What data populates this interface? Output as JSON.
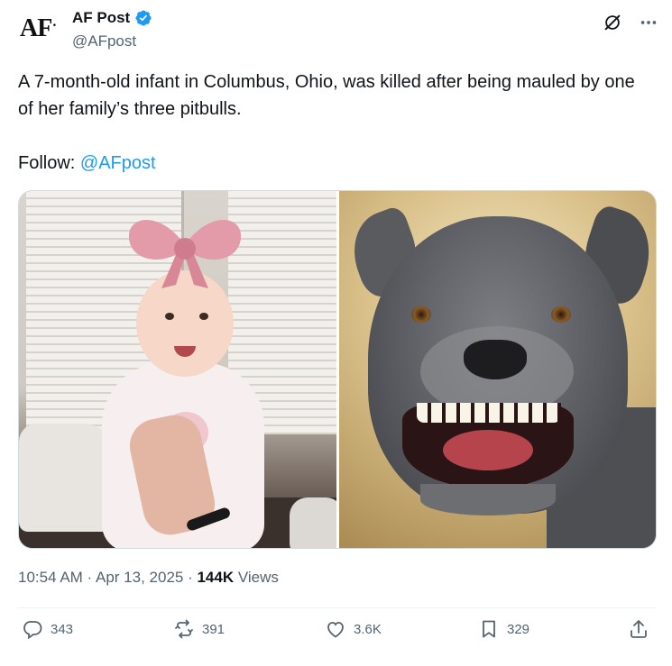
{
  "author": {
    "logo_text": "AF",
    "logo_dot": ".",
    "display_name": "AF Post",
    "handle": "@AFpost"
  },
  "tweet": {
    "text": "A 7-month-old infant in Columbus, Ohio, was killed after being mauled by one of her family’s three pitbulls.",
    "follow_label": "Follow: ",
    "follow_mention": "@AFpost"
  },
  "meta": {
    "time": "10:54 AM",
    "separator": " · ",
    "date": "Apr 13, 2025",
    "views_count": "144K",
    "views_label": " Views"
  },
  "actions": {
    "replies": "343",
    "reposts": "391",
    "likes": "3.6K",
    "bookmarks": "329"
  },
  "icons": {
    "verified": "verified-badge-icon",
    "grok": "grok-icon",
    "more": "more-icon",
    "reply": "reply-icon",
    "repost": "repost-icon",
    "like": "heart-icon",
    "bookmark": "bookmark-icon",
    "share": "share-icon"
  },
  "colors": {
    "accent": "#1d9bf0",
    "text": "#0f1419",
    "secondary": "#536471"
  }
}
